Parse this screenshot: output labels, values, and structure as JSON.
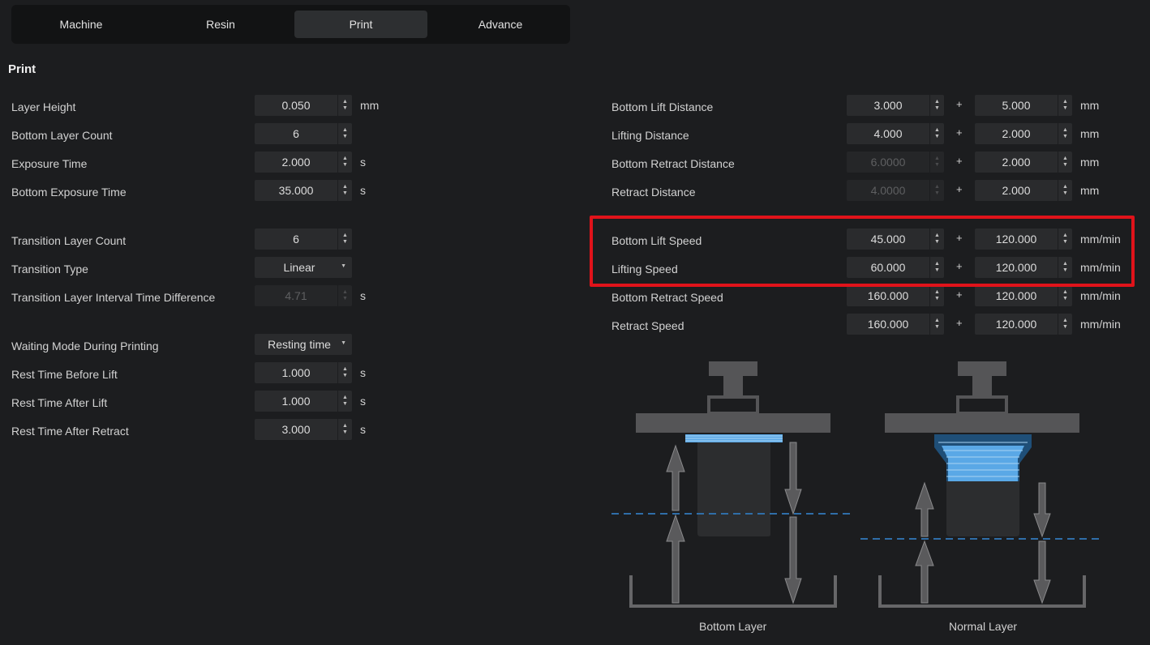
{
  "tabs": [
    {
      "label": "Machine"
    },
    {
      "label": "Resin"
    },
    {
      "label": "Print"
    },
    {
      "label": "Advance"
    }
  ],
  "section_title": "Print",
  "left": {
    "layer_height": {
      "label": "Layer Height",
      "value": "0.050",
      "unit": "mm"
    },
    "bottom_layer_count": {
      "label": "Bottom Layer Count",
      "value": "6"
    },
    "exposure_time": {
      "label": "Exposure Time",
      "value": "2.000",
      "unit": "s"
    },
    "bottom_exposure_time": {
      "label": "Bottom Exposure Time",
      "value": "35.000",
      "unit": "s"
    },
    "transition_layer_count": {
      "label": "Transition Layer Count",
      "value": "6"
    },
    "transition_type": {
      "label": "Transition Type",
      "value": "Linear"
    },
    "transition_interval": {
      "label": "Transition Layer Interval Time Difference",
      "value": "4.71",
      "unit": "s"
    },
    "waiting_mode": {
      "label": "Waiting Mode During Printing",
      "value": "Resting time"
    },
    "rest_before_lift": {
      "label": "Rest Time Before Lift",
      "value": "1.000",
      "unit": "s"
    },
    "rest_after_lift": {
      "label": "Rest Time After Lift",
      "value": "1.000",
      "unit": "s"
    },
    "rest_after_retract": {
      "label": "Rest Time After Retract",
      "value": "3.000",
      "unit": "s"
    }
  },
  "right": {
    "bottom_lift_distance": {
      "label": "Bottom Lift Distance",
      "value1": "3.000",
      "value2": "5.000",
      "unit": "mm"
    },
    "lifting_distance": {
      "label": "Lifting Distance",
      "value1": "4.000",
      "value2": "2.000",
      "unit": "mm"
    },
    "bottom_retract_distance": {
      "label": "Bottom Retract Distance",
      "value1": "6.0000",
      "value2": "2.000",
      "unit": "mm"
    },
    "retract_distance": {
      "label": "Retract Distance",
      "value1": "4.0000",
      "value2": "2.000",
      "unit": "mm"
    },
    "bottom_lift_speed": {
      "label": "Bottom Lift Speed",
      "value1": "45.000",
      "value2": "120.000",
      "unit": "mm/min"
    },
    "lifting_speed": {
      "label": "Lifting Speed",
      "value1": "60.000",
      "value2": "120.000",
      "unit": "mm/min"
    },
    "bottom_retract_speed": {
      "label": "Bottom Retract Speed",
      "value1": "160.000",
      "value2": "120.000",
      "unit": "mm/min"
    },
    "retract_speed": {
      "label": "Retract Speed",
      "value1": "160.000",
      "value2": "120.000",
      "unit": "mm/min"
    }
  },
  "plus_sign": "+",
  "diagram": {
    "bottom_caption": "Bottom Layer",
    "normal_caption": "Normal Layer"
  },
  "colors": {
    "highlight": "#e0131a",
    "layer_blue": "#5aa8e6",
    "dash_blue": "#2f6ea8"
  }
}
